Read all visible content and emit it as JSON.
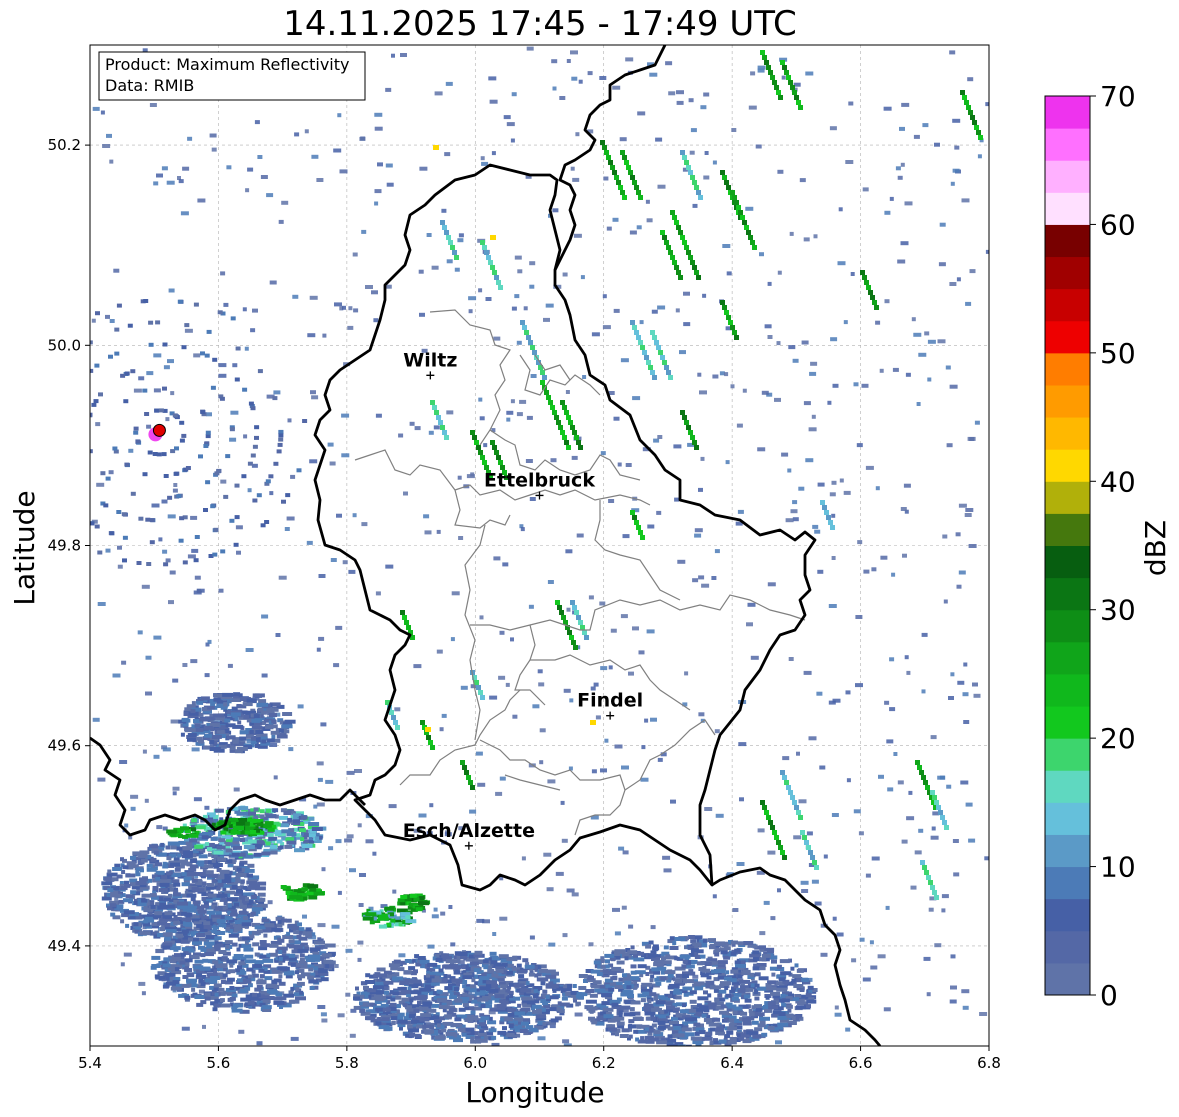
{
  "title": "14.11.2025 17:45 - 17:49 UTC",
  "info_box": {
    "product_line": "Product: Maximum Reflectivity",
    "data_line": "Data: RMIB"
  },
  "axes": {
    "xlabel": "Longitude",
    "ylabel": "Latitude",
    "xlim": [
      5.4,
      6.8
    ],
    "ylim": [
      49.3,
      50.3
    ],
    "xticks": [
      "5.4",
      "5.6",
      "5.8",
      "6.0",
      "6.2",
      "6.4",
      "6.6",
      "6.8"
    ],
    "yticks": [
      "49.4",
      "49.6",
      "49.8",
      "50.0",
      "50.2"
    ]
  },
  "colorbar": {
    "label": "dBZ",
    "ticks": [
      "0",
      "10",
      "20",
      "30",
      "40",
      "50",
      "60",
      "70"
    ],
    "colors": [
      "#5f73a8",
      "#5468a6",
      "#4660a6",
      "#4c7bb7",
      "#5b9ac7",
      "#65c0db",
      "#5fd8c0",
      "#3dd56d",
      "#12c81e",
      "#10b81c",
      "#10a51a",
      "#0e8e16",
      "#0b7614",
      "#075e10",
      "#45780d",
      "#b1b00a",
      "#ffd800",
      "#ffb800",
      "#ff9b00",
      "#ff7d00",
      "#ee0000",
      "#c80000",
      "#a00000",
      "#780000",
      "#ffe0ff",
      "#ffb0ff",
      "#ff70ff",
      "#ee33ee"
    ]
  },
  "cities": [
    {
      "name": "Wiltz",
      "lon": 5.93,
      "lat": 49.97
    },
    {
      "name": "Ettelbruck",
      "lon": 6.1,
      "lat": 49.85
    },
    {
      "name": "Findel",
      "lon": 6.21,
      "lat": 49.63
    },
    {
      "name": "Esch/Alzette",
      "lon": 5.99,
      "lat": 49.5
    }
  ],
  "radar_marker": {
    "lon": 5.505,
    "lat": 49.915
  }
}
